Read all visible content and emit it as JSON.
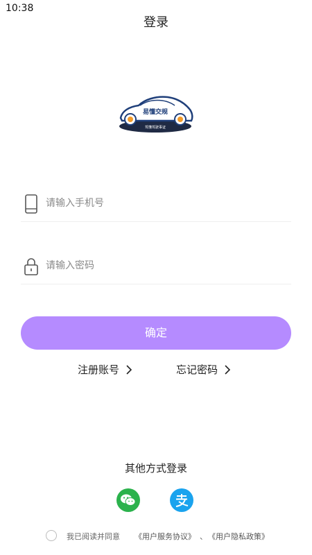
{
  "status_bar": {
    "time": "10:38"
  },
  "header": {
    "title": "登录"
  },
  "logo": {
    "name": "易懂交规",
    "tagline": "驾懂驾驶事证"
  },
  "form": {
    "phone_placeholder": "请输入手机号",
    "password_placeholder": "请输入密码",
    "confirm_label": "确定"
  },
  "links": {
    "register": "注册账号",
    "forgot": "忘记密码"
  },
  "other_login": {
    "title": "其他方式登录",
    "methods": [
      {
        "icon": "wechat-icon",
        "color": "#2bb24c"
      },
      {
        "icon": "alipay-icon",
        "color": "#1aa3ee"
      }
    ]
  },
  "agreement": {
    "prefix": "我已阅读并同意",
    "service": "《用户服务协议》",
    "separator": "、",
    "privacy": "《用户隐私政策》"
  },
  "colors": {
    "accent": "#b58bff",
    "divider": "#eeeeee"
  }
}
